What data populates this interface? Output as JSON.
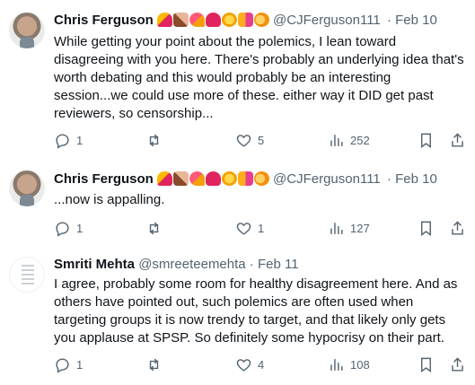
{
  "tweets": [
    {
      "author_name": "Chris Ferguson",
      "handle": "@CJFerguson111 ",
      "separator": "·",
      "date": "Feb 10",
      "text": "While getting your point about the polemics, I lean toward disagreeing with you here.  There's probably an underlying idea that's worth debating and this would probably be an interesting session...we could use more of these.  either way it DID get past reviewers, so censorship...",
      "replies": "1",
      "retweets": "",
      "likes": "5",
      "views": "252"
    },
    {
      "author_name": "Chris Ferguson",
      "handle": "@CJFerguson111 ",
      "separator": "·",
      "date": "Feb 10",
      "text": "...now is appalling.",
      "replies": "1",
      "retweets": "",
      "likes": "1",
      "views": "127"
    },
    {
      "author_name": "Smriti Mehta",
      "handle": "@smreeteemehta",
      "separator": "·",
      "date": "Feb 11",
      "text": "I agree, probably some room for healthy disagreement here. And as others have pointed out, such polemics are often used when targeting groups it is now trendy to target, and that likely only gets you applause at SPSP. So definitely some hypocrisy on their part.",
      "replies": "1",
      "retweets": "",
      "likes": "4",
      "views": "108"
    }
  ],
  "icons": {
    "reply": "reply-icon",
    "retweet": "retweet-icon",
    "like": "heart-icon",
    "views": "views-icon",
    "bookmark": "bookmark-icon",
    "share": "share-icon"
  },
  "colors": {
    "text": "#0f1419",
    "secondary": "#536471",
    "background": "#ffffff"
  }
}
